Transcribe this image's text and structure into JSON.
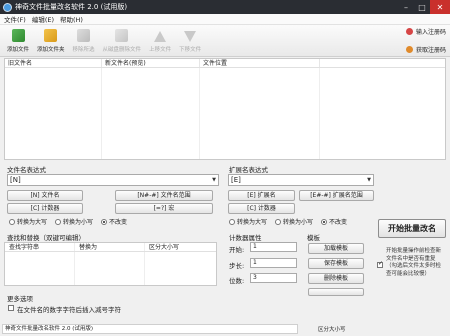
{
  "window": {
    "title": "神奇文件批量改名软件 2.0 (试用版)"
  },
  "menu": [
    "文件(F)",
    "编辑(E)",
    "帮助(H)"
  ],
  "toolbar": {
    "items": [
      {
        "label": "添加文件",
        "icon": "add-file-icon",
        "enabled": true
      },
      {
        "label": "添加文件夹",
        "icon": "add-folder-icon",
        "enabled": true
      },
      {
        "label": "移除所选",
        "icon": "remove-selected-icon",
        "enabled": false
      },
      {
        "label": "从磁盘删除文件",
        "icon": "delete-from-disk-icon",
        "enabled": false
      },
      {
        "label": "上移文件",
        "icon": "move-up-icon",
        "enabled": false
      },
      {
        "label": "下移文件",
        "icon": "move-down-icon",
        "enabled": false
      }
    ],
    "enter_code": "输入注册码",
    "get_code": "获取注册码"
  },
  "filelist": {
    "columns": [
      "旧文件名",
      "新文件名(预览)",
      "文件位置"
    ]
  },
  "filename_expr": {
    "label": "文件名表达式",
    "value": "[N]",
    "buttons": [
      "[N] 文件名",
      "[N#-#] 文件名范围",
      "[C] 计数器",
      "[=?] 宏"
    ],
    "radios": [
      "转换为大写",
      "转换为小写",
      "不改变"
    ],
    "selected": 2
  },
  "ext_expr": {
    "label": "扩展名表达式",
    "value": "[E]",
    "buttons": [
      "[E] 扩展名",
      "[E#-#] 扩展名范围",
      "[C] 计数器"
    ],
    "radios": [
      "转换为大写",
      "转换为小写",
      "不改变"
    ],
    "selected": 2
  },
  "replace": {
    "label": "查找和替换（双键可编辑）",
    "columns": [
      "查找字符串",
      "替换为",
      "区分大小写"
    ]
  },
  "counter": {
    "label": "计数器属性",
    "start_label": "开始:",
    "start": "1",
    "step_label": "步长:",
    "step": "1",
    "digits_label": "位数:",
    "digits": "3"
  },
  "template": {
    "label": "模板",
    "buttons": [
      "加载模板",
      "保存模板",
      "删除模板"
    ]
  },
  "start_button": "开始批量改名",
  "hint": "开始批量操作前检查新文件名中是否有重复（勾选后文件太多时检查可能会比较慢）",
  "more": {
    "label": "更多选项",
    "option": "在文件名的数字字符后插入减号字符"
  },
  "status": {
    "left": "神奇文件批量改名软件 2.0 (试用版)",
    "right": "区分大小写"
  }
}
